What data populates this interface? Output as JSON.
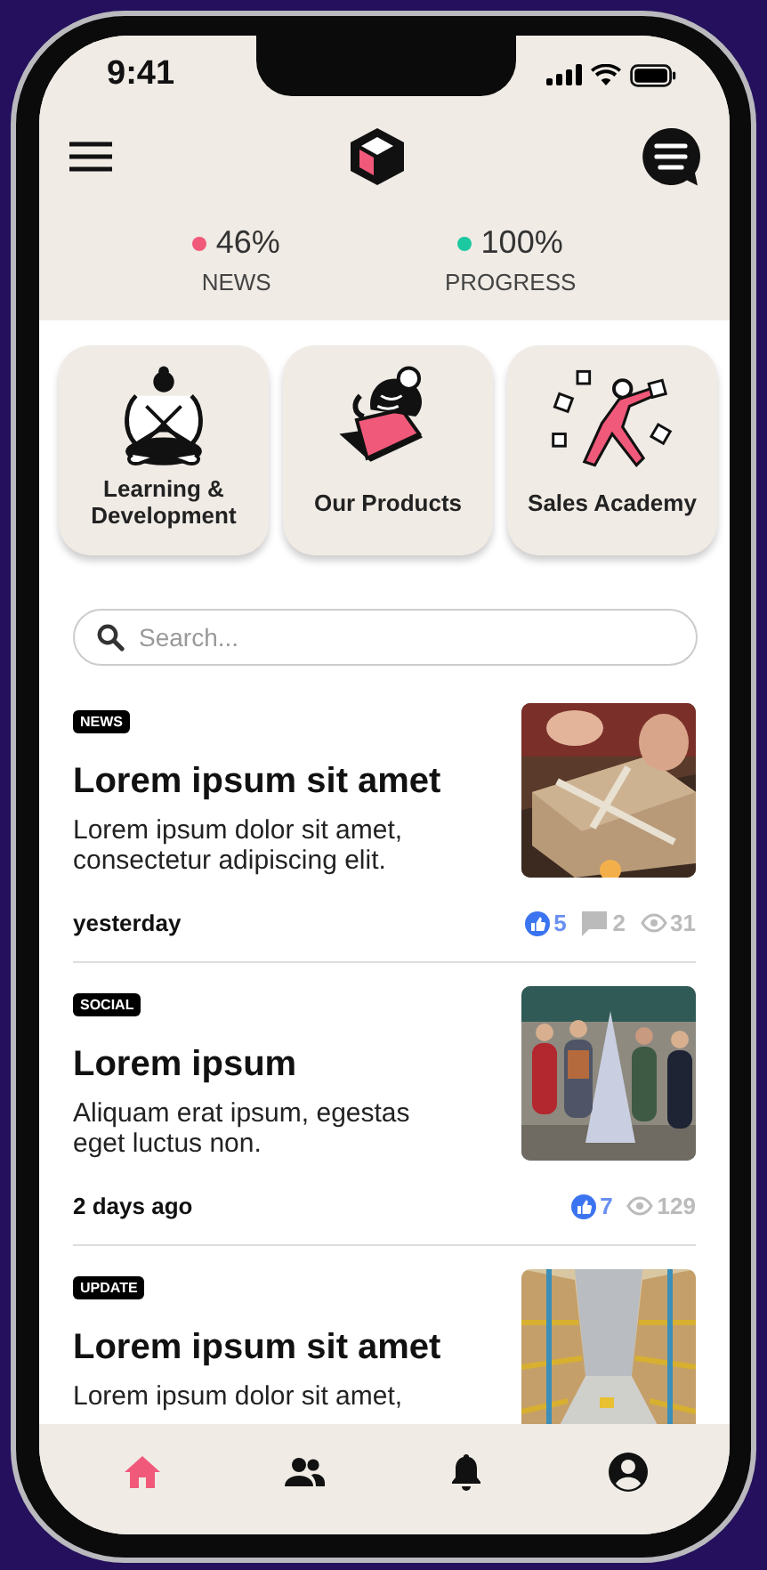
{
  "status_bar": {
    "time": "9:41"
  },
  "stats": [
    {
      "value": "46%",
      "label": "NEWS",
      "color": "#f0597a"
    },
    {
      "value": "100%",
      "label": "PROGRESS",
      "color": "#1cc8a0"
    }
  ],
  "categories": [
    {
      "label": "Learning & Development",
      "kind": "reading"
    },
    {
      "label": "Our Products",
      "kind": "box"
    },
    {
      "label": "Sales Academy",
      "kind": "juggling"
    }
  ],
  "search": {
    "placeholder": "Search..."
  },
  "articles": [
    {
      "tag": "NEWS",
      "title": "Lorem ipsum sit amet",
      "description": "Lorem ipsum dolor sit amet, consectetur adipiscing elit.",
      "time": "yesterday",
      "counts": [
        {
          "kind": "likes",
          "value": "5"
        },
        {
          "kind": "comments",
          "value": "2"
        },
        {
          "kind": "views",
          "value": "31"
        }
      ]
    },
    {
      "tag": "SOCIAL",
      "title": "Lorem ipsum",
      "description": "Aliquam erat ipsum, egestas eget luctus non.",
      "time": "2 days ago",
      "counts": [
        {
          "kind": "likes",
          "value": "7"
        },
        {
          "kind": "views",
          "value": "129"
        }
      ]
    },
    {
      "tag": "UPDATE",
      "title": "Lorem ipsum sit amet",
      "description": "Lorem ipsum dolor sit amet,"
    }
  ],
  "nav": [
    {
      "kind": "home",
      "selected": true
    },
    {
      "kind": "people",
      "selected": false
    },
    {
      "kind": "bell",
      "selected": false
    },
    {
      "kind": "profile",
      "selected": false
    }
  ]
}
